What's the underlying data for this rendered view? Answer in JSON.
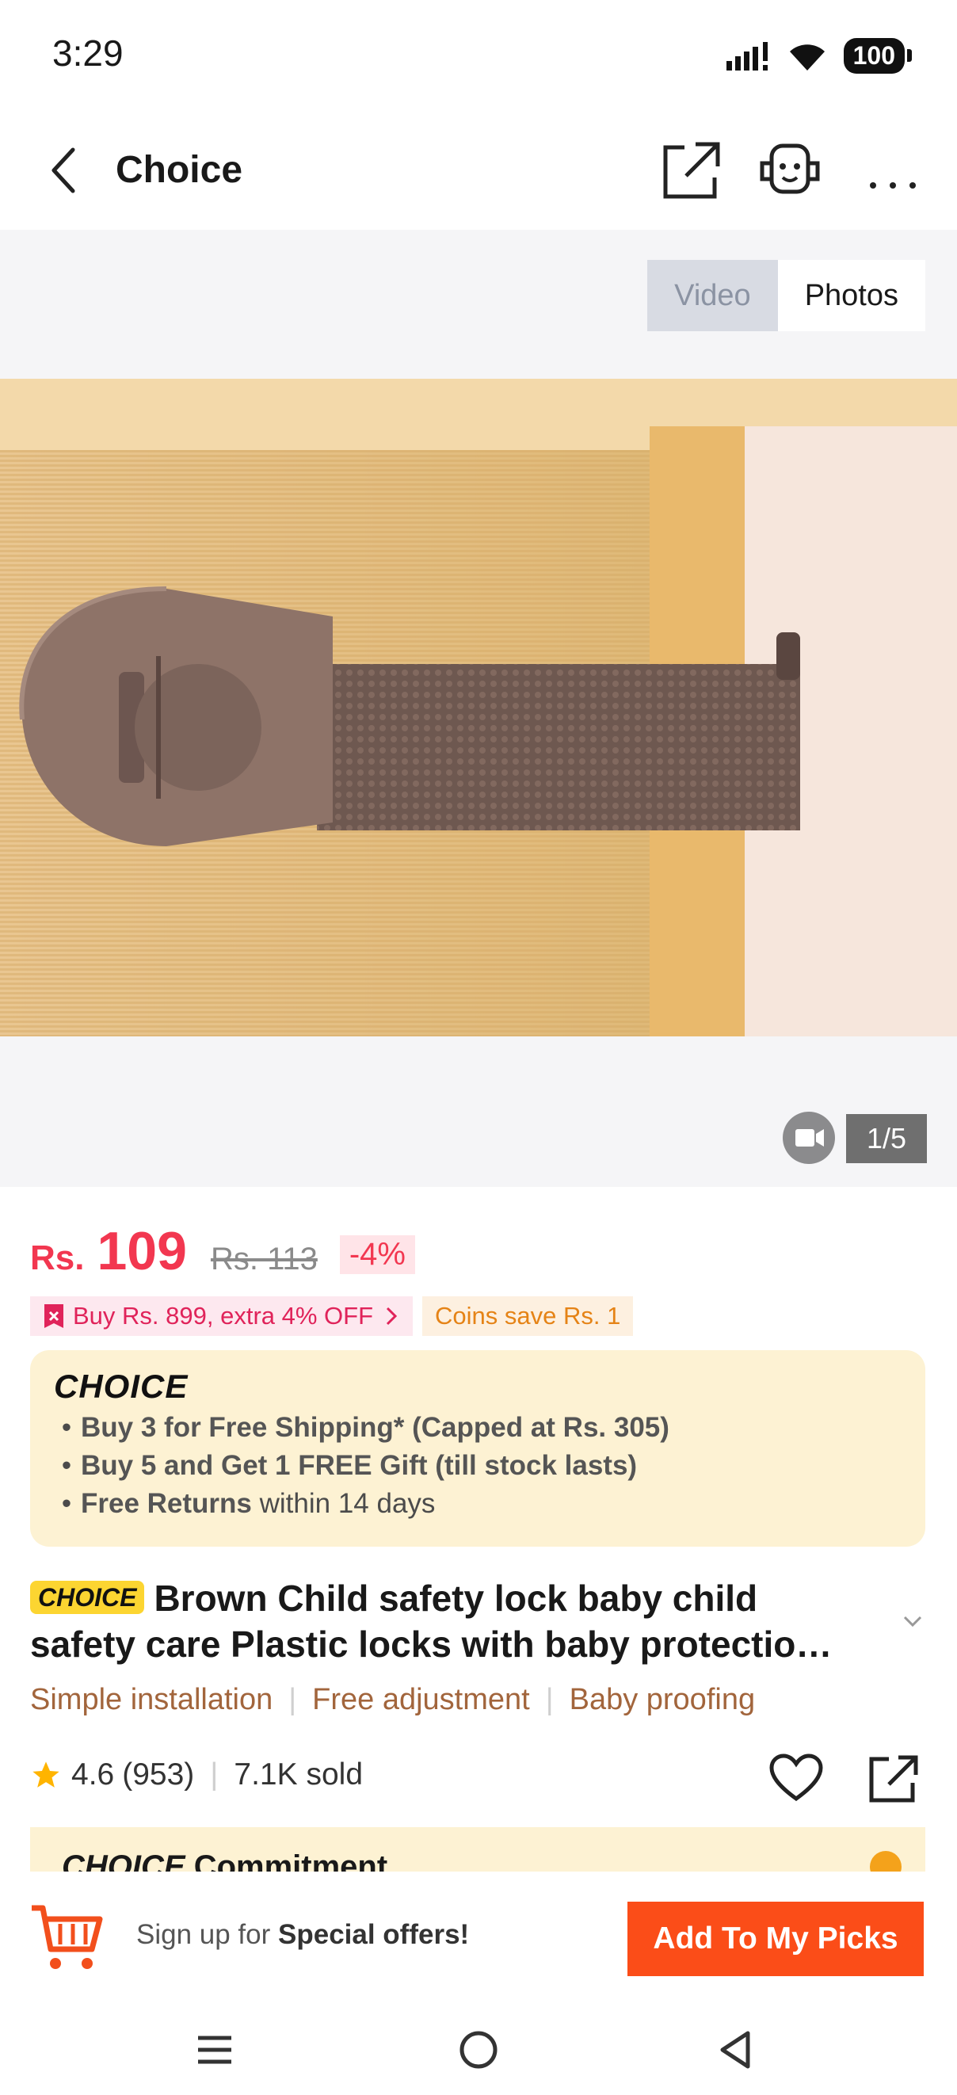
{
  "status_bar": {
    "time": "3:29",
    "battery": "100"
  },
  "header": {
    "title": "Choice"
  },
  "gallery": {
    "tabs": [
      "Video",
      "Photos"
    ],
    "active_tab": "Photos",
    "counter": "1/5"
  },
  "price": {
    "currency": "Rs.",
    "current": "109",
    "original": "Rs. 113",
    "discount": "-4%"
  },
  "promos": {
    "bundle": "Buy Rs. 899, extra 4% OFF",
    "coins": "Coins save Rs. 1"
  },
  "choice": {
    "logo": "CHOICE",
    "benefits": [
      "Buy 3 for  Free Shipping* (Capped at Rs. 305)",
      "Buy 5 and Get 1 FREE Gift (till stock lasts)"
    ],
    "returns_bold": "Free Returns",
    "returns_rest": " within 14 days"
  },
  "product": {
    "tag": "CHOICE",
    "title": "Brown Child safety lock baby child safety care Plastic locks with baby protectio…",
    "features": [
      "Simple installation",
      "Free adjustment",
      "Baby proofing"
    ],
    "rating": "4.6",
    "reviews": "(953)",
    "sold": "7.1K sold"
  },
  "commitment": {
    "logo": "CHOICE",
    "label": "Commitment"
  },
  "bottom_bar": {
    "signup_prefix": "Sign up for ",
    "signup_bold": "Special offers!",
    "add_button": "Add To My Picks"
  },
  "colors": {
    "price_red": "#f23750",
    "action_orange": "#fb4d18",
    "choice_bg": "#fdf2d3",
    "feature_brown": "#a2653c"
  }
}
